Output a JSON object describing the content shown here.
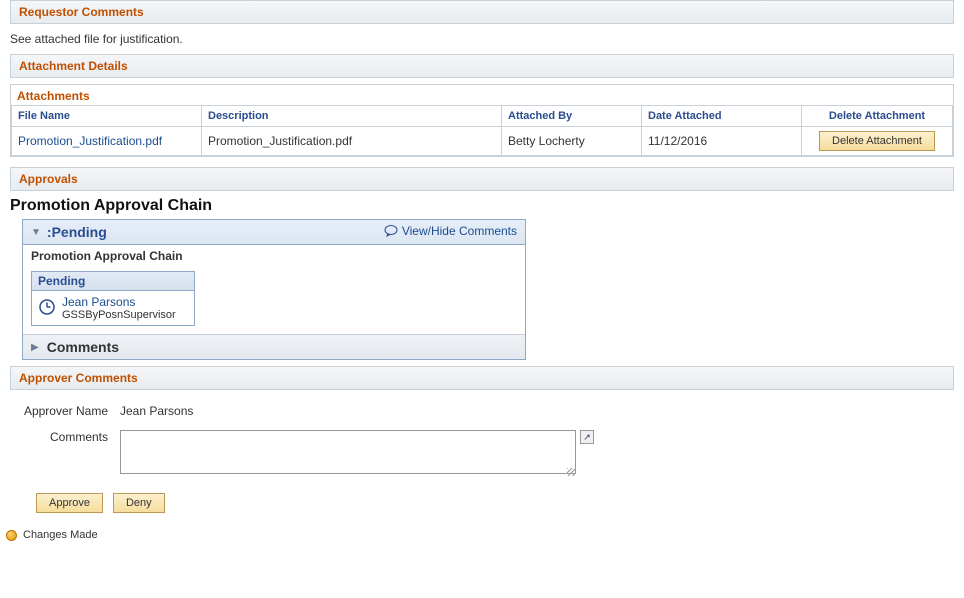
{
  "requestor_comments": {
    "header": "Requestor Comments",
    "text": "See attached file for justification."
  },
  "attachment_details": {
    "header": "Attachment Details",
    "table_label": "Attachments",
    "columns": {
      "file_name": "File Name",
      "description": "Description",
      "attached_by": "Attached By",
      "date_attached": "Date Attached",
      "delete": "Delete Attachment"
    },
    "rows": [
      {
        "file_name": "Promotion_Justification.pdf",
        "description": "Promotion_Justification.pdf",
        "attached_by": "Betty Locherty",
        "date_attached": "11/12/2016",
        "delete_label": "Delete Attachment"
      }
    ]
  },
  "approvals": {
    "header": "Approvals",
    "chain_title": "Promotion Approval Chain",
    "status_label": ":Pending",
    "view_hide_label": "View/Hide Comments",
    "sub_label": "Promotion Approval Chain",
    "pending_card": {
      "header": "Pending",
      "name": "Jean Parsons",
      "role": "GSSByPosnSupervisor"
    },
    "comments_label": "Comments"
  },
  "approver_comments": {
    "header": "Approver Comments",
    "approver_name_label": "Approver Name",
    "approver_name_value": "Jean Parsons",
    "comments_label": "Comments",
    "approve_label": "Approve",
    "deny_label": "Deny"
  },
  "changes_made": {
    "label": "Changes Made"
  }
}
